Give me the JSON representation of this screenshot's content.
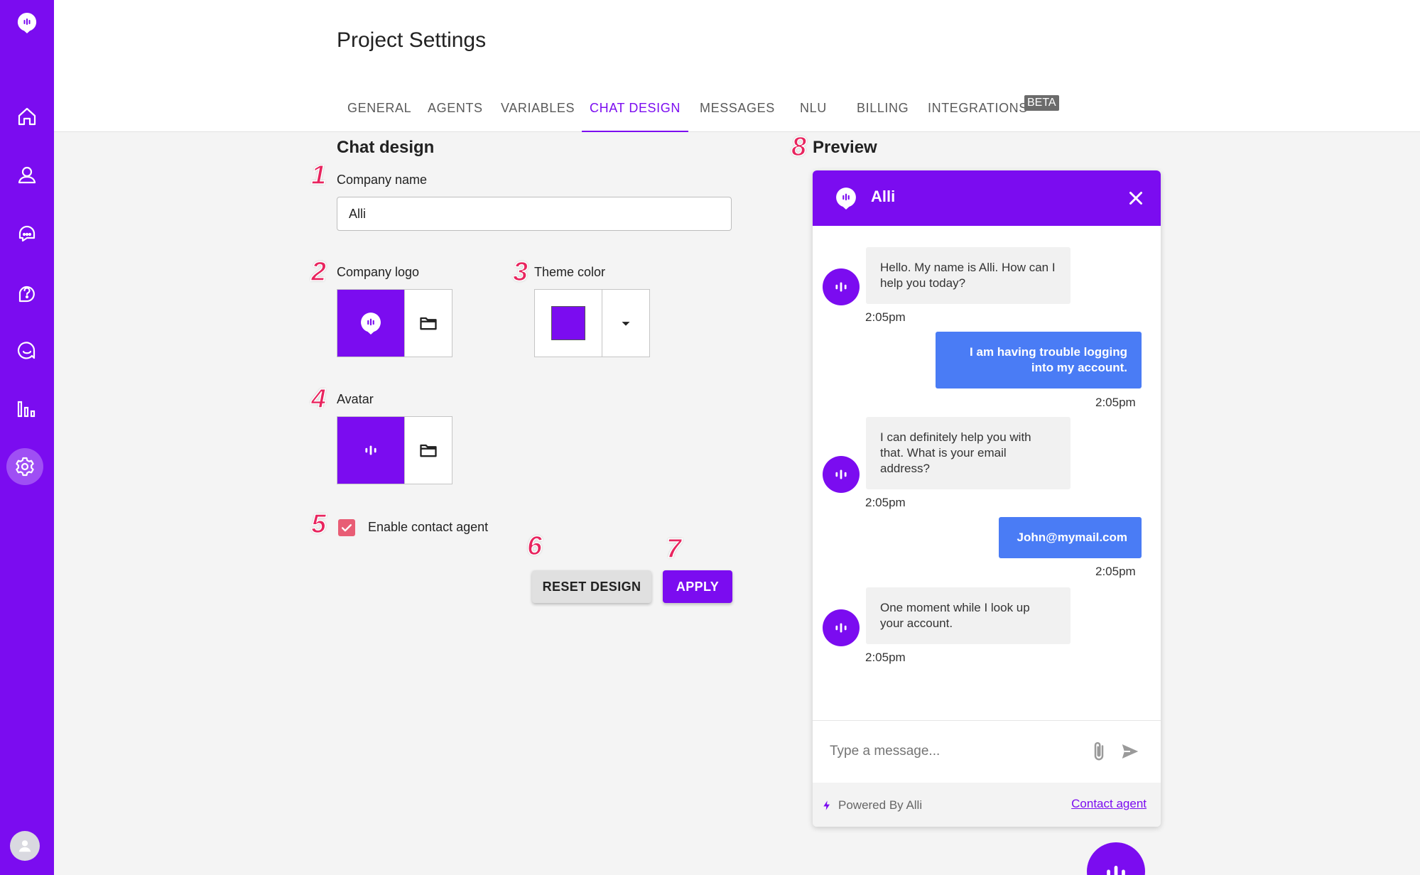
{
  "page": {
    "title": "Project Settings"
  },
  "tabs": [
    {
      "label": "GENERAL"
    },
    {
      "label": "AGENTS"
    },
    {
      "label": "VARIABLES"
    },
    {
      "label": "CHAT DESIGN",
      "active": true
    },
    {
      "label": "MESSAGES"
    },
    {
      "label": "NLU"
    },
    {
      "label": "BILLING"
    },
    {
      "label": "INTEGRATIONS",
      "badge": "BETA"
    }
  ],
  "sidebar": {
    "icons": [
      "logo-icon",
      "home-icon",
      "user-icon",
      "chat-agent-icon",
      "help-icon",
      "conversation-icon",
      "analytics-icon",
      "settings-icon",
      "account-avatar-icon"
    ],
    "active": "settings-icon"
  },
  "markers": [
    "1",
    "2",
    "3",
    "4",
    "5",
    "6",
    "7",
    "8"
  ],
  "form": {
    "section_title": "Chat design",
    "company_name": {
      "label": "Company name",
      "value": "Alli"
    },
    "company_logo": {
      "label": "Company logo"
    },
    "theme_color": {
      "label": "Theme color",
      "value": "#7b0cf0"
    },
    "avatar": {
      "label": "Avatar"
    },
    "enable_contact_agent": {
      "label": "Enable contact agent",
      "checked": true
    },
    "reset_label": "RESET DESIGN",
    "apply_label": "APPLY"
  },
  "preview": {
    "section_title": "Preview",
    "bot_name": "Alli",
    "messages": [
      {
        "from": "bot",
        "text": "Hello. My name is Alli. How can I help you today?",
        "time": "2:05pm"
      },
      {
        "from": "user",
        "text": "I am having trouble logging into my account.",
        "time": "2:05pm"
      },
      {
        "from": "bot",
        "text": "I can definitely help you with that. What is your email address?",
        "time": "2:05pm"
      },
      {
        "from": "user",
        "text": "John@mymail.com",
        "time": "2:05pm"
      },
      {
        "from": "bot",
        "text": "One moment while I look up your account.",
        "time": "2:05pm"
      }
    ],
    "input_placeholder": "Type a message...",
    "powered_by": "Powered By Alli",
    "contact_link": "Contact agent"
  },
  "colors": {
    "brand": "#7b0cf0",
    "user_bubble": "#4a7cf5",
    "marker": "#e8245e",
    "checkbox": "#e85d75"
  }
}
